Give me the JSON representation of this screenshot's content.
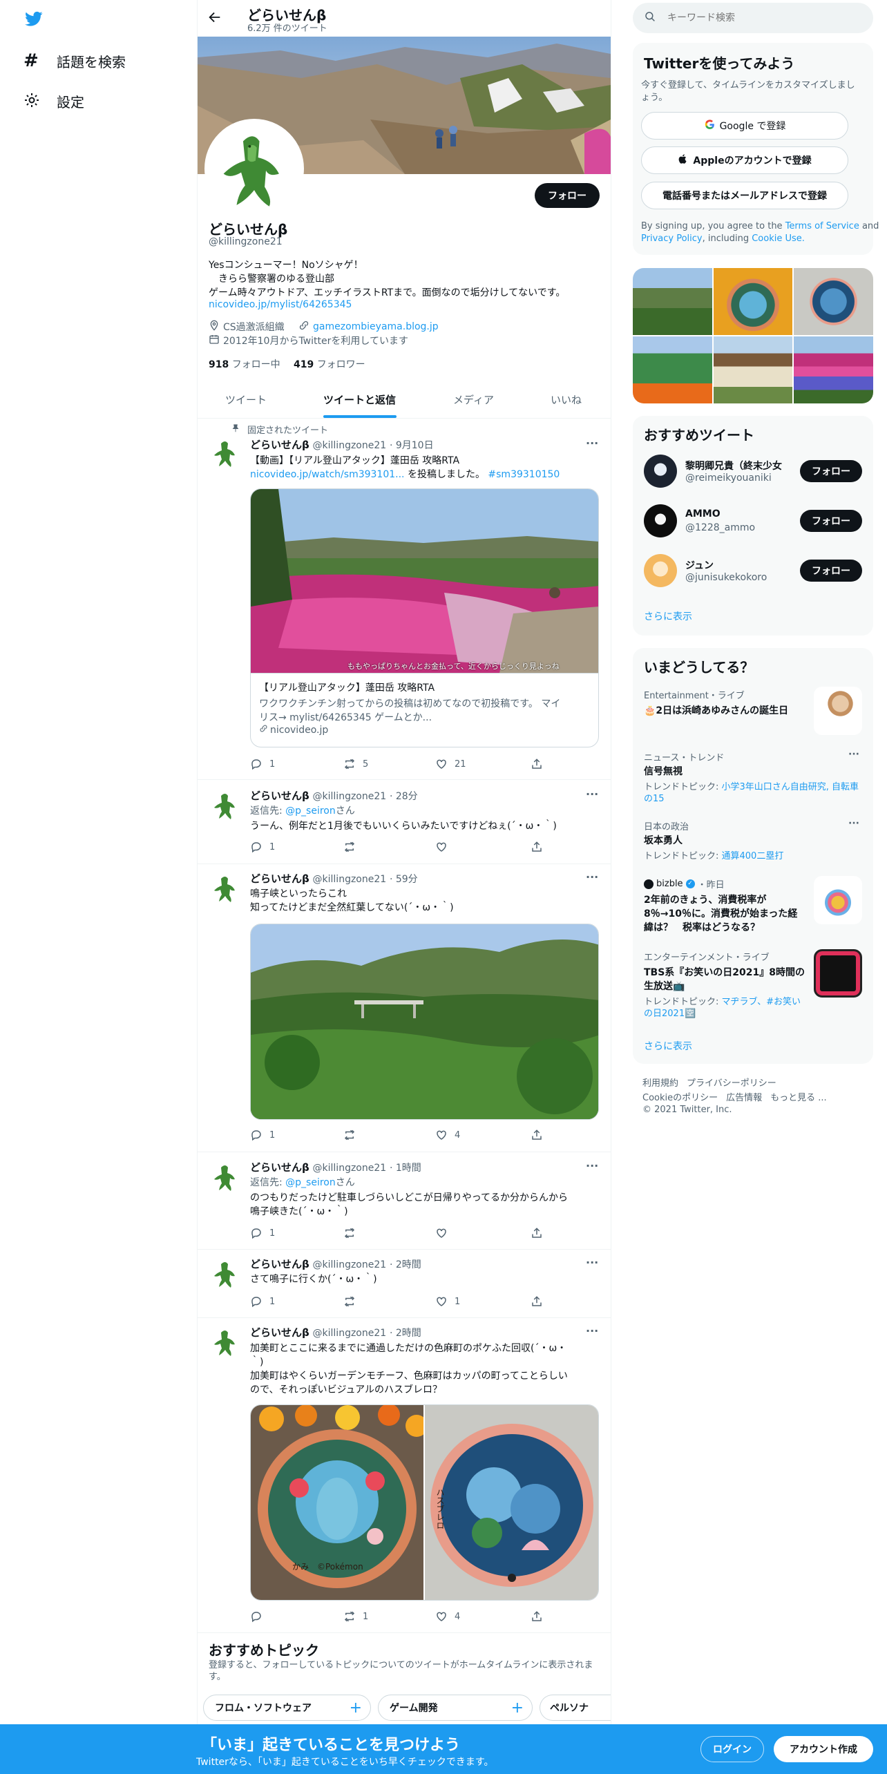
{
  "left_nav": {
    "explore": "話題を検索",
    "settings": "設定"
  },
  "header": {
    "name": "どらいせんβ",
    "tweet_count": "6.2万 件のツイート"
  },
  "profile": {
    "name": "どらいせんβ",
    "handle": "@killingzone21",
    "follow": "フォロー",
    "bio1": "Yesコンシューマー！Noソシャゲ！",
    "bio2": "　きらら警察署のゆる登山部",
    "bio3": "ゲーム時々アウトドア、エッチイラストRTまで。面倒なので垢分けしてないです。",
    "bio_link": "nicovideo.jp/mylist/64265345",
    "location": "CS過激派組織",
    "website": "gamezombieyama.blog.jp",
    "joined": "2012年10月からTwitterを利用しています",
    "following_count": "918",
    "following_label": "フォロー中",
    "followers_count": "419",
    "followers_label": "フォロワー"
  },
  "tabs": [
    "ツイート",
    "ツイートと返信",
    "メディア",
    "いいね"
  ],
  "tweets": [
    {
      "pinned": "固定されたツイート",
      "name": "どらいせんβ",
      "handle": "@killingzone21",
      "time": "· 9月10日",
      "line1": "【動画】【リアル登山アタック】蓬田岳 攻略RTA",
      "link": "nicovideo.jp/watch/sm393101...",
      "line2_rest": " を投稿しました。",
      "hashtag": "#sm39310150",
      "image_caption": "ももやっぱりちゃんとお金払って、近くからじっくり見よっね",
      "card_title": "【リアル登山アタック】蓬田岳 攻略RTA",
      "card_desc1": "ワクワクチンチン射ってからの投稿は初めてなので初投稿です。 マイ",
      "card_desc2": "リス→ mylist/64265345 ゲームとか...",
      "card_domain": "nicovideo.jp",
      "replies": "1",
      "retweets": "5",
      "likes": "21"
    },
    {
      "name": "どらいせんβ",
      "handle": "@killingzone21",
      "time": "· 28分",
      "reply_prefix": "返信先: ",
      "reply_to": "@p_seiron",
      "reply_suffix": "さん",
      "text1": "うーん、例年だと1月後でもいいくらいみたいですけどねぇ(´・ω・｀)",
      "replies": "1",
      "retweets": "",
      "likes": ""
    },
    {
      "name": "どらいせんβ",
      "handle": "@killingzone21",
      "time": "· 59分",
      "text1": "鳴子峡といったらこれ",
      "text2": "知ってたけどまだ全然紅葉してない(´・ω・｀)",
      "replies": "1",
      "retweets": "",
      "likes": "4"
    },
    {
      "name": "どらいせんβ",
      "handle": "@killingzone21",
      "time": "· 1時間",
      "reply_prefix": "返信先: ",
      "reply_to": "@p_seiron",
      "reply_suffix": "さん",
      "text1": "のつもりだったけど駐車しづらいしどこが日帰りやってるか分からんから",
      "text2": "鳴子峡きた(´・ω・｀)",
      "replies": "1",
      "retweets": "",
      "likes": ""
    },
    {
      "name": "どらいせんβ",
      "handle": "@killingzone21",
      "time": "· 2時間",
      "text1": "さて鳴子に行くか(´・ω・｀)",
      "replies": "1",
      "retweets": "",
      "likes": "1"
    },
    {
      "name": "どらいせんβ",
      "handle": "@killingzone21",
      "time": "· 2時間",
      "text1": "加美町とここに来るまでに通過しただけの色麻町のポケふた回収(´・ω・",
      "text2": "｀)",
      "text3": "加美町はやくらいガーデンモチーフ、色麻町はカッパの町ってことらしい",
      "text4": "ので、それっぽいビジュアルのハスブレロ？",
      "lid1_text": "かみ　©Pokémon",
      "lid2_text": "ハスブレロ",
      "replies": "",
      "retweets": "1",
      "likes": "4"
    }
  ],
  "topics": {
    "title": "おすすめトピック",
    "desc1": "登録すると、フォローしているトピックについてのツイートがホームタイムラインに表示されま",
    "desc2": "す。",
    "items": [
      "フロム・ソフトウェア",
      "ゲーム開発",
      "ペルソナ"
    ]
  },
  "search": {
    "placeholder": "キーワード検索"
  },
  "signup": {
    "title": "Twitterを使ってみよう",
    "desc1": "今すぐ登録して、タイムラインをカスタマイズしまし",
    "desc2": "ょう。",
    "google": "Google で登録",
    "apple": "Appleのアカウントで登録",
    "phone": "電話番号またはメールアドレスで登録",
    "terms_pre": "By signing up, you agree to the ",
    "terms": "Terms of Service",
    "and": " and",
    "privacy": "Privacy Policy",
    "including": ", including ",
    "cookie": "Cookie Use."
  },
  "who_to_follow": {
    "title": "おすすめツイート",
    "users": [
      {
        "name": "黎明卿兄貴（終末少女）",
        "handle": "@reimeikyouaniki"
      },
      {
        "name": "AMMO",
        "handle": "@1228_ammo"
      },
      {
        "name": "ジュン",
        "handle": "@junisukekokoro"
      }
    ],
    "follow": "フォロー",
    "more": "さらに表示"
  },
  "trends": {
    "title": "いまどうしてる？",
    "items": [
      {
        "meta": "Entertainment・ライブ",
        "title": "🎂2日は浜崎あゆみさんの誕生日"
      },
      {
        "meta": "ニュース・トレンド",
        "title": "信号無視",
        "topic_label": "トレンドトピック: ",
        "topic": "小学3年山口さん自由研究, 自転車",
        "topic2": "の15"
      },
      {
        "meta": "日本の政治",
        "title": "坂本勇人",
        "topic_label": "トレンドトピック: ",
        "topic": "通算400二塁打"
      },
      {
        "source": "bizble",
        "meta_time": "・昨日",
        "title1": "2年前のきょう、消費税率が",
        "title2": "8％→10％に。消費税が始まった経",
        "title3": "緯は？　税率はどうなる？"
      },
      {
        "meta": "エンターテインメント・ライブ",
        "title1": "TBS系『お笑いの日2021』8時間の",
        "title2": "生放送📺",
        "topic_label": "トレンドトピック: ",
        "topic": "マヂラブ、#お笑い",
        "topic2": "の日2021🈳"
      }
    ],
    "more": "さらに表示"
  },
  "footer": {
    "terms": "利用規約",
    "privacy": "プライバシーポリシー",
    "cookie": "Cookieのポリシー",
    "ads": "広告情報",
    "more": "もっと見る ...",
    "copyright": "© 2021 Twitter, Inc."
  },
  "bottom_bar": {
    "title": "「いま」起きていることを見つけよう",
    "subtitle": "Twitterなら、「いま」起きていることをいち早くチェックできます。",
    "login": "ログイン",
    "signup": "アカウント作成"
  },
  "colors": {
    "accent": "#1d9bf0",
    "bottom_bar": "#1d9bf0",
    "text": "#0f1419",
    "secondary": "#536471"
  }
}
